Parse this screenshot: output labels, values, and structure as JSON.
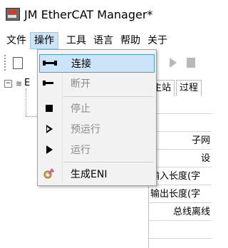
{
  "window": {
    "title": "JM EtherCAT Manager*"
  },
  "menu_bar": {
    "items": [
      {
        "label": "文件"
      },
      {
        "label": "操作"
      },
      {
        "label": "工具"
      },
      {
        "label": "语言"
      },
      {
        "label": "帮助"
      },
      {
        "label": "关于"
      }
    ]
  },
  "tree": {
    "root_label": "E"
  },
  "right_pane": {
    "tabs": [
      {
        "label": "主站"
      },
      {
        "label": "过程"
      }
    ],
    "rows": [
      {
        "text": ""
      },
      {
        "text": ""
      },
      {
        "text": "子网"
      },
      {
        "text": "设"
      },
      {
        "text": "输入长度(字"
      },
      {
        "text": "输出长度(字"
      },
      {
        "text": "总线离线"
      },
      {
        "text": ""
      }
    ]
  },
  "operations_menu": {
    "items": [
      {
        "label": "连接",
        "icon": "connect-icon",
        "enabled": true
      },
      {
        "label": "断开",
        "icon": "disconnect-icon",
        "enabled": false
      },
      {
        "label": "停止",
        "icon": "stop-icon",
        "enabled": false
      },
      {
        "label": "预运行",
        "icon": "pre-run-icon",
        "enabled": false
      },
      {
        "label": "运行",
        "icon": "run-icon",
        "enabled": false
      },
      {
        "label": "生成ENI",
        "icon": "generate-eni-icon",
        "enabled": true
      }
    ]
  }
}
